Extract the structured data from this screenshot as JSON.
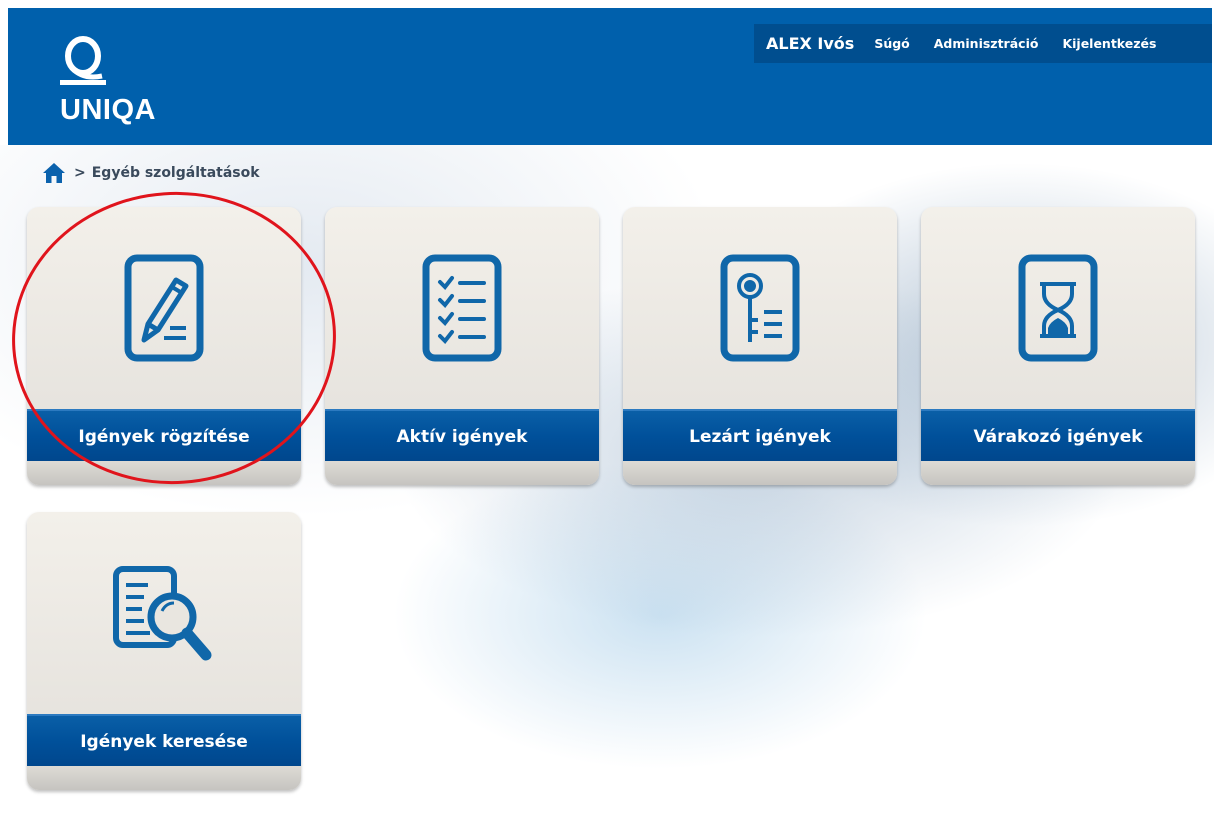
{
  "header": {
    "logo_text": "UNIQA",
    "user": "ALEX Ivós",
    "links": [
      "Súgó",
      "Adminisztráció",
      "Kijelentkezés"
    ]
  },
  "breadcrumb": {
    "separator": ">",
    "current": "Egyéb szolgáltatások"
  },
  "tiles": [
    {
      "label": "Igények rögzítése",
      "icon": "pencil-document-icon",
      "highlighted": true
    },
    {
      "label": "Aktív igények",
      "icon": "checklist-icon"
    },
    {
      "label": "Lezárt igények",
      "icon": "key-document-icon"
    },
    {
      "label": "Várakozó igények",
      "icon": "hourglass-icon"
    },
    {
      "label": "Igények keresése",
      "icon": "document-search-icon"
    }
  ],
  "colors": {
    "brand_blue": "#0060ac",
    "nav_dark_blue": "#004e8f",
    "icon_blue": "#1067a9",
    "highlight_red": "#e0141c"
  }
}
